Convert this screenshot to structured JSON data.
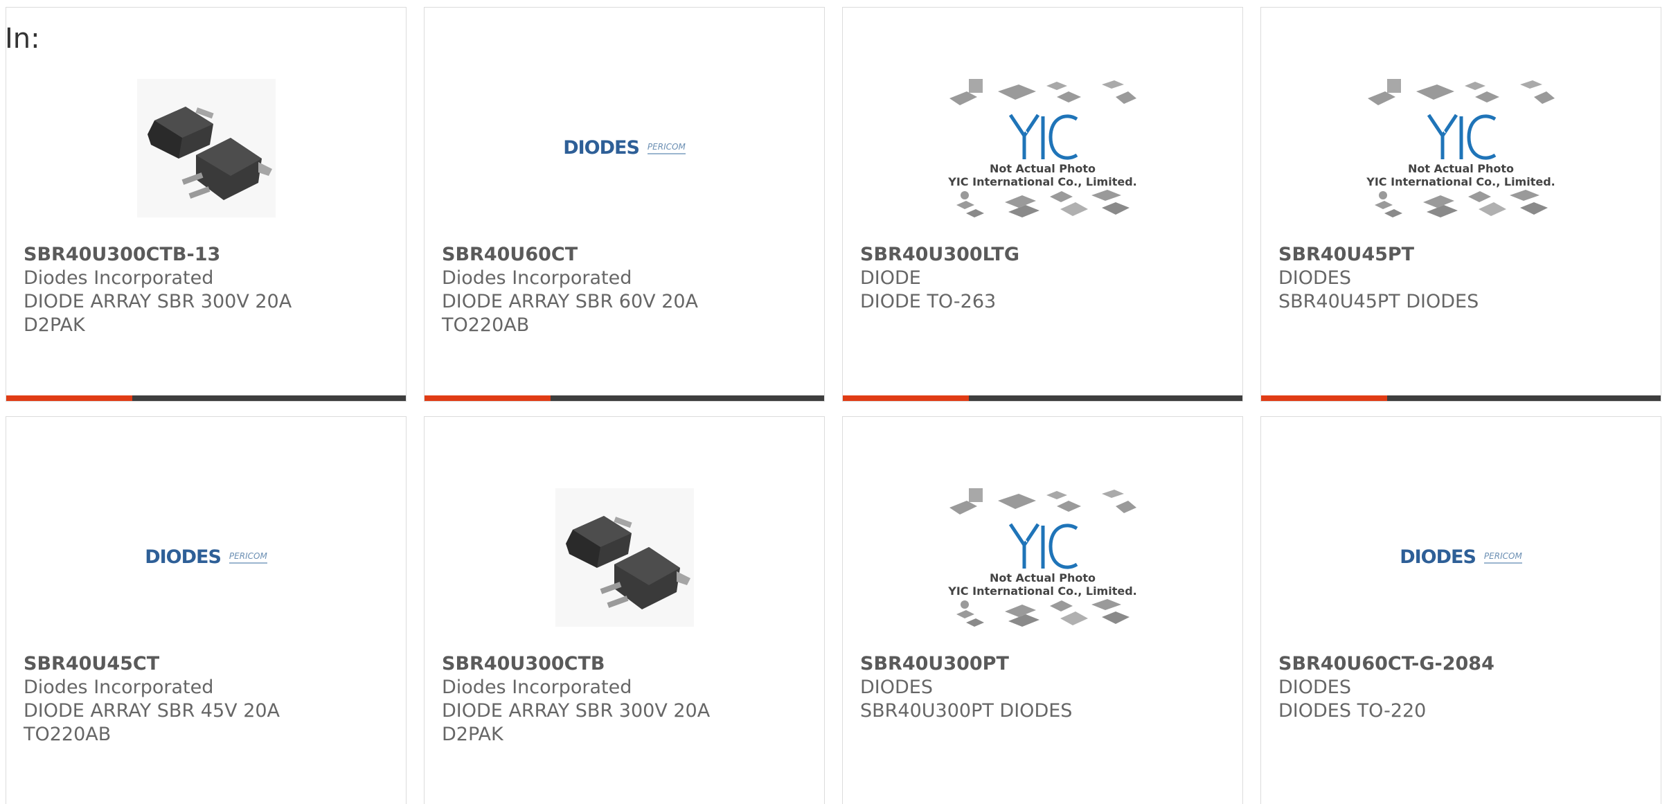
{
  "header": {
    "in_label": "In:"
  },
  "colors": {
    "accent": "#e03c15",
    "bar": "#3e3e3e",
    "text": "#666666"
  },
  "products": [
    {
      "part_number": "SBR40U300CTB-13",
      "manufacturer": "Diodes Incorporated",
      "desc1": "DIODE ARRAY SBR 300V 20A",
      "desc2": "D2PAK",
      "image": "d2pak-photo"
    },
    {
      "part_number": "SBR40U60CT",
      "manufacturer": "Diodes Incorporated",
      "desc1": "DIODE ARRAY SBR 60V 20A",
      "desc2": "TO220AB",
      "image": "diodes-logo",
      "logo_word": "DIODES",
      "logo_sub": "PERICOM"
    },
    {
      "part_number": "SBR40U300LTG",
      "manufacturer": "DIODE",
      "desc1": "DIODE TO-263",
      "desc2": "",
      "image": "yic-placeholder",
      "caption1": "Not Actual Photo",
      "caption2": "YIC International Co., Limited."
    },
    {
      "part_number": "SBR40U45PT",
      "manufacturer": "DIODES",
      "desc1": "SBR40U45PT DIODES",
      "desc2": "",
      "image": "yic-placeholder",
      "caption1": "Not Actual Photo",
      "caption2": "YIC International Co., Limited."
    },
    {
      "part_number": "SBR40U45CT",
      "manufacturer": "Diodes Incorporated",
      "desc1": "DIODE ARRAY SBR 45V 20A",
      "desc2": "TO220AB",
      "image": "diodes-logo",
      "logo_word": "DIODES",
      "logo_sub": "PERICOM"
    },
    {
      "part_number": "SBR40U300CTB",
      "manufacturer": "Diodes Incorporated",
      "desc1": "DIODE ARRAY SBR 300V 20A",
      "desc2": "D2PAK",
      "image": "d2pak-photo"
    },
    {
      "part_number": "SBR40U300PT",
      "manufacturer": "DIODES",
      "desc1": "SBR40U300PT DIODES",
      "desc2": "",
      "image": "yic-placeholder",
      "caption1": "Not Actual Photo",
      "caption2": "YIC International Co., Limited."
    },
    {
      "part_number": "SBR40U60CT-G-2084",
      "manufacturer": "DIODES",
      "desc1": "DIODES TO-220",
      "desc2": "",
      "image": "diodes-logo",
      "logo_word": "DIODES",
      "logo_sub": "PERICOM"
    }
  ]
}
